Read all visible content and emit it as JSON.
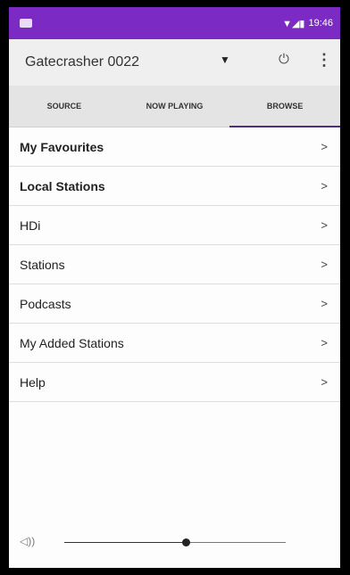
{
  "status_bar": {
    "time": "19:46",
    "signal_icons": "▼◢▮"
  },
  "toolbar": {
    "device_name": "Gatecrasher 0022",
    "dropdown_glyph": "▼",
    "power_glyph": "⏻",
    "more_glyph": "⋮"
  },
  "tabs": [
    {
      "label": "SOURCE",
      "active": false
    },
    {
      "label": "NOW PLAYING",
      "active": false
    },
    {
      "label": "BROWSE",
      "active": true
    }
  ],
  "menu": {
    "items": [
      {
        "label": "My Favourites",
        "bold": true
      },
      {
        "label": "Local Stations",
        "bold": true
      },
      {
        "label": "HDi",
        "bold": false
      },
      {
        "label": "Stations",
        "bold": false
      },
      {
        "label": "Podcasts",
        "bold": false
      },
      {
        "label": "My Added Stations",
        "bold": false
      },
      {
        "label": "Help",
        "bold": false
      }
    ],
    "chevron": ">"
  },
  "volume": {
    "icon_glyph": "◁))",
    "level_fraction": 0.55
  },
  "colors": {
    "status_bar": "#7b2bc4",
    "accent": "#4b2e86"
  }
}
